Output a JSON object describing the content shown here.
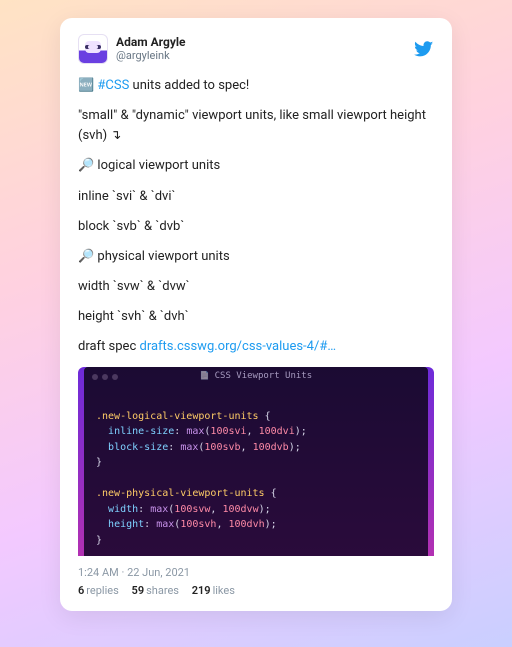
{
  "author": {
    "display_name": "Adam Argyle",
    "handle": "@argyleink"
  },
  "tweet": {
    "line1_emoji": "🆕 ",
    "line1_hashtag": "#CSS",
    "line1_rest": " units added to spec!",
    "line2": "\"small\" & \"dynamic\" viewport units, like small viewport height (svh) ↴",
    "line3": "🔎 logical viewport units",
    "line4": "inline `svi` & `dvi`",
    "line5": "block `svb` & `dvb`",
    "line6": "🔎 physical viewport units",
    "line7": "width `svw` & `dvw`",
    "line8": "height `svh` & `dvh`",
    "link_prefix": "draft spec ",
    "link_text": "drafts.csswg.org/css-values-4/#…"
  },
  "code": {
    "title": "CSS Viewport Units",
    "sel1": ".new-logical-viewport-units",
    "p1a": "inline-size",
    "f1a": "max",
    "v1a1": "100svi",
    "v1a2": "100dvi",
    "p1b": "block-size",
    "f1b": "max",
    "v1b1": "100svb",
    "v1b2": "100dvb",
    "sel2": ".new-physical-viewport-units",
    "p2a": "width",
    "f2a": "max",
    "v2a1": "100svw",
    "v2a2": "100dvw",
    "p2b": "height",
    "f2b": "max",
    "v2b1": "100svh",
    "v2b2": "100dvh"
  },
  "meta": {
    "time": "1:24 AM",
    "sep": " · ",
    "date": "22 Jun, 2021"
  },
  "stats": {
    "replies_n": "6",
    "replies_l": "replies",
    "shares_n": "59",
    "shares_l": "shares",
    "likes_n": "219",
    "likes_l": "likes"
  }
}
